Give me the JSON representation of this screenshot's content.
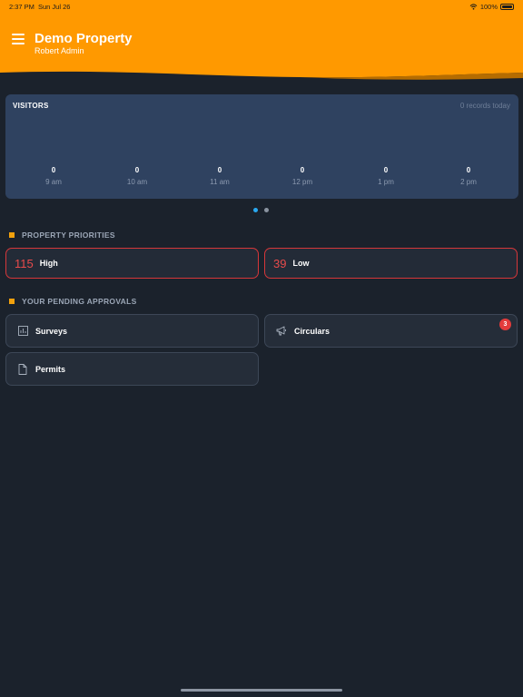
{
  "status_bar": {
    "time": "2:37 PM",
    "date": "Sun Jul 26",
    "battery": "100%"
  },
  "header": {
    "title": "Demo Property",
    "subtitle": "Robert Admin",
    "accent_color": "#ff9900"
  },
  "visitors": {
    "title": "VISITORS",
    "records_text": "0 records today",
    "hours": [
      {
        "value": "0",
        "label": "9 am"
      },
      {
        "value": "0",
        "label": "10 am"
      },
      {
        "value": "0",
        "label": "11 am"
      },
      {
        "value": "0",
        "label": "12 pm"
      },
      {
        "value": "0",
        "label": "1 pm"
      },
      {
        "value": "0",
        "label": "2 pm"
      }
    ]
  },
  "pager": {
    "pages": 2,
    "active": 1
  },
  "priorities": {
    "title": "PROPERTY PRIORITIES",
    "items": [
      {
        "count": "115",
        "label": "High"
      },
      {
        "count": "39",
        "label": "Low"
      }
    ]
  },
  "approvals": {
    "title": "YOUR PENDING APPROVALS",
    "items": [
      {
        "label": "Surveys",
        "icon": "chart-icon"
      },
      {
        "label": "Circulars",
        "icon": "megaphone-icon",
        "badge": "3"
      },
      {
        "label": "Permits",
        "icon": "document-icon"
      }
    ]
  }
}
